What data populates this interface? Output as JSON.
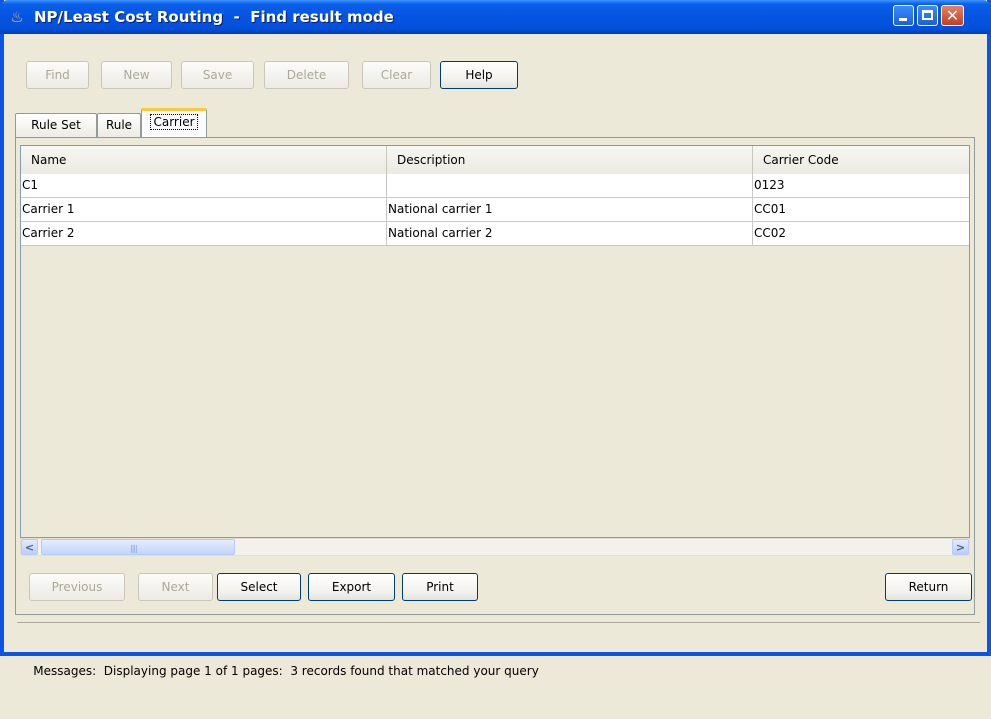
{
  "window": {
    "title": "NP/Least Cost Routing  -  Find result mode",
    "app_icon": "java-cup-icon",
    "close_glyph": "✕"
  },
  "toolbar": {
    "find_label": "Find",
    "new_label": "New",
    "save_label": "Save",
    "delete_label": "Delete",
    "clear_label": "Clear",
    "help_label": "Help"
  },
  "tabs": [
    {
      "label": "Rule Set",
      "active": false
    },
    {
      "label": "Rule",
      "active": false
    },
    {
      "label": "Carrier",
      "active": true
    }
  ],
  "table": {
    "columns": [
      "Name",
      "Description",
      "Carrier Code"
    ],
    "rows": [
      [
        "C1",
        "",
        "0123"
      ],
      [
        "Carrier 1",
        "National carrier 1",
        "CC01"
      ],
      [
        "Carrier 2",
        "National carrier 2",
        "CC02"
      ]
    ]
  },
  "scrollbar": {
    "left_arrow": "<",
    "right_arrow": ">",
    "grip": "||||"
  },
  "navigation": {
    "previous_label": "Previous",
    "next_label": "Next",
    "select_label": "Select",
    "export_label": "Export",
    "print_label": "Print",
    "return_label": "Return"
  },
  "status": {
    "message": "Messages:  Displaying page 1 of 1 pages:  3 records found that matched your query"
  },
  "colors": {
    "titlebar": "#0554E2",
    "window_bg": "#ECE9D8",
    "active_tab_accent": "#FFC83C"
  }
}
